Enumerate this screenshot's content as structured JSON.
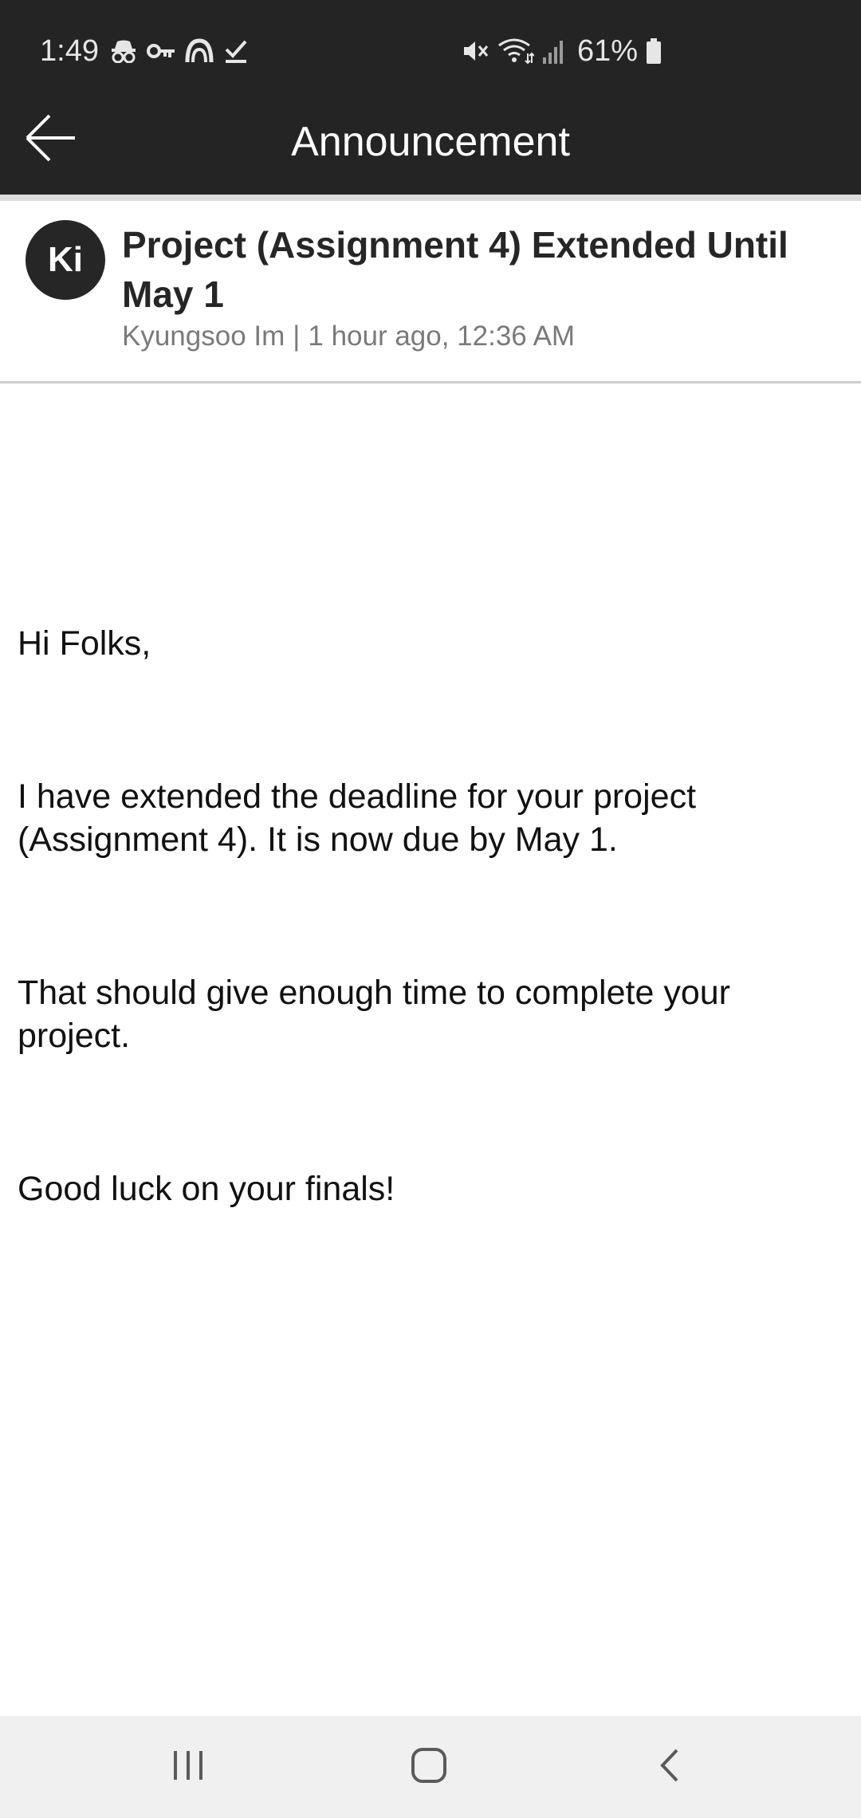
{
  "status_bar": {
    "time": "1:49",
    "left_icons": [
      "incognito-icon",
      "key-icon",
      "cloud-arc-icon",
      "checkmark-icon"
    ],
    "right_icons": [
      "mute-icon",
      "wifi-icon",
      "signal-icon",
      "battery-icon"
    ],
    "battery_percent": "61%"
  },
  "app_bar": {
    "title": "Announcement",
    "back_icon": "arrow-left-icon"
  },
  "post": {
    "avatar_initials": "Ki",
    "title": "Project (Assignment 4) Extended Until May 1",
    "author": "Kyungsoo Im",
    "separator": "|",
    "time": "1 hour ago, 12:36 AM",
    "body": {
      "greeting": "Hi Folks,",
      "paragraph_1": "I have extended the deadline for your project (Assignment 4). It is now due by May 1.",
      "paragraph_2": "That should give enough time to complete your project.",
      "paragraph_3": "Good luck on your finals!"
    }
  },
  "nav_bar": {
    "recents_icon": "recents-icon",
    "home_icon": "home-icon",
    "back_icon": "back-chevron-icon"
  },
  "colors": {
    "app_bar_bg": "#242424",
    "avatar_bg": "#262626",
    "meta_text": "#7a7a7a",
    "nav_bar_bg": "#f0f0f0"
  }
}
